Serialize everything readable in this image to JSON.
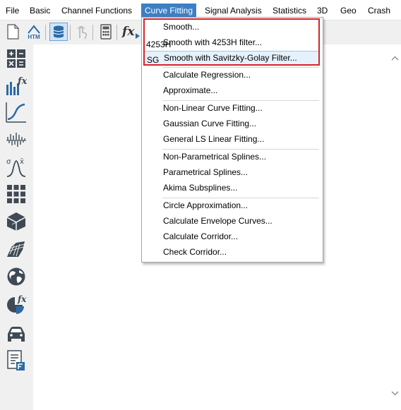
{
  "menubar": {
    "items": [
      "File",
      "Basic",
      "Channel Functions",
      "Curve Fitting",
      "Signal Analysis",
      "Statistics",
      "3D",
      "Geo",
      "Crash"
    ],
    "active_index": 3
  },
  "toolbar": {
    "icons": [
      "new-file-icon",
      "html-export-icon",
      "database-icon",
      "touch-icon",
      "calculator-icon",
      "formula-icon"
    ],
    "html_icon_text": "HTM",
    "fx_text": "fx"
  },
  "sidebar": {
    "icons": [
      "calculator-functions-icon",
      "fx-bars-icon",
      "curve-fitting-icon",
      "signal-analysis-icon",
      "statistics-icon",
      "grid-icon",
      "cube-3d-icon",
      "surface-3d-icon",
      "globe-icon",
      "pie-fx-icon",
      "car-crash-icon",
      "report-icon"
    ],
    "fx_text": "fx"
  },
  "dropdown": {
    "items": [
      {
        "label": "Smooth...",
        "icon": "smooth-icon",
        "group": 0
      },
      {
        "label": "Smooth with 4253H filter...",
        "icon": "smooth-4253h-icon",
        "group": 0
      },
      {
        "label": "Smooth with Savitzky-Golay Filter...",
        "icon": "smooth-sg-icon",
        "group": 0
      },
      {
        "label": "Calculate Regression...",
        "icon": "regression-icon",
        "group": 1
      },
      {
        "label": "Approximate...",
        "icon": "approximate-icon",
        "group": 1
      },
      {
        "label": "Non-Linear Curve Fitting...",
        "icon": "nonlinear-fit-icon",
        "group": 2
      },
      {
        "label": "Gaussian Curve Fitting...",
        "icon": "gaussian-fit-icon",
        "group": 2
      },
      {
        "label": "General LS Linear Fitting...",
        "icon": "ls-linear-fit-icon",
        "group": 2
      },
      {
        "label": "Non-Parametrical Splines...",
        "icon": "nonparam-spline-icon",
        "group": 3
      },
      {
        "label": "Parametrical Splines...",
        "icon": "param-spline-icon",
        "group": 3
      },
      {
        "label": "Akima Subsplines...",
        "icon": "akima-spline-icon",
        "group": 3
      },
      {
        "label": "Circle Approximation...",
        "icon": "circle-approx-icon",
        "group": 4
      },
      {
        "label": "Calculate Envelope Curves...",
        "icon": "envelope-icon",
        "group": 4
      },
      {
        "label": "Calculate Corridor...",
        "icon": "corridor-icon",
        "group": 4
      },
      {
        "label": "Check Corridor...",
        "icon": "check-corridor-icon",
        "group": 4
      }
    ],
    "hovered_index": 2,
    "icon_texts": {
      "smooth-4253h-icon": "4253H",
      "smooth-sg-icon": "SG"
    }
  },
  "colors": {
    "accent": "#3c7fc4",
    "highlight_border": "#d8232a",
    "icon_blue": "#2b6aa5",
    "icon_red": "#c8102e",
    "icon_dark": "#3f4a55"
  }
}
